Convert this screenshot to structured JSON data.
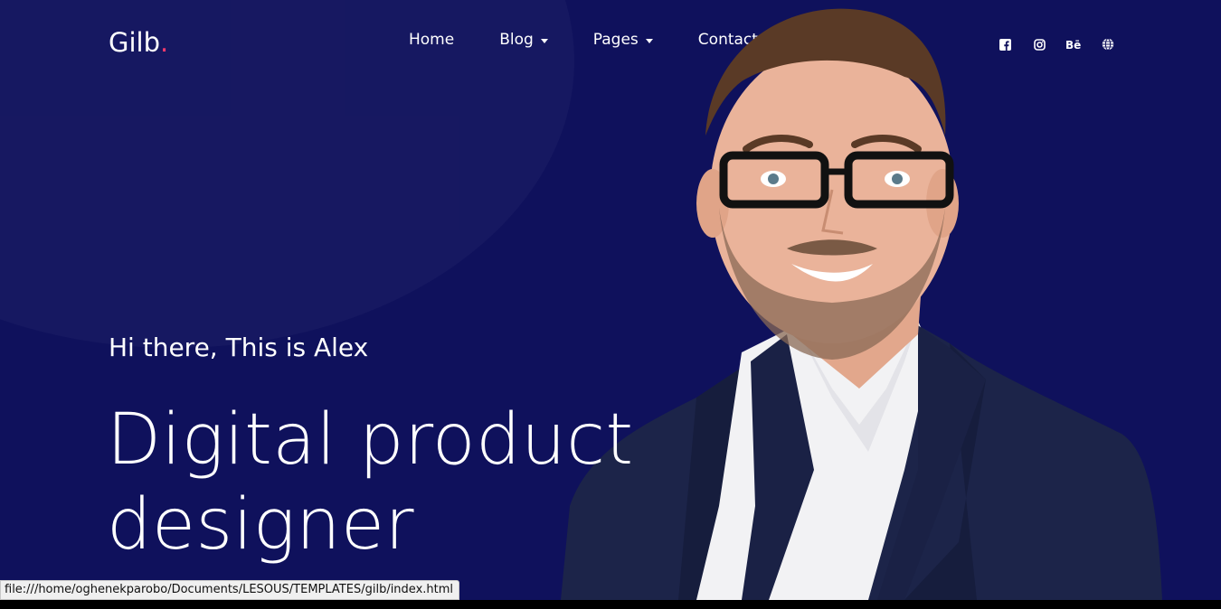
{
  "header": {
    "logo_text": "Gilb",
    "logo_dot": ".",
    "nav": [
      {
        "label": "Home",
        "dropdown": false
      },
      {
        "label": "Blog",
        "dropdown": true
      },
      {
        "label": "Pages",
        "dropdown": true
      },
      {
        "label": "Contact",
        "dropdown": false
      }
    ],
    "socials": [
      "facebook-icon",
      "instagram-icon",
      "behance-icon",
      "globe-icon"
    ]
  },
  "hero": {
    "greeting": "Hi there, This is Alex",
    "headline_line1": "Digital product",
    "headline_line2": "designer"
  },
  "status_bar": {
    "url": "file:///home/oghenekparobo/Documents/LESOUS/TEMPLATES/gilb/index.html"
  },
  "colors": {
    "background": "#0f115c",
    "accent": "#ff3b6b",
    "text": "#ffffff"
  }
}
